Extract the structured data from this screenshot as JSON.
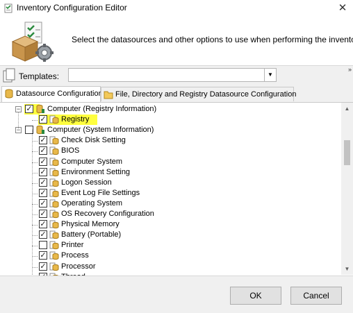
{
  "window": {
    "title": "Inventory Configuration Editor"
  },
  "header": {
    "text": "Select the datasources and other options to use when performing the inventory"
  },
  "templates": {
    "label": "Templates:",
    "value": ""
  },
  "tabs": [
    {
      "label": "Datasource Configuration",
      "active": true
    },
    {
      "label": "File, Directory and Registry Datasource Configuration",
      "active": false
    }
  ],
  "tree": {
    "nodes": [
      {
        "label": "Computer (Registry Information)",
        "checked": true,
        "expander": "minus",
        "highlighted": true
      },
      {
        "label": "Registry",
        "checked": true,
        "highlighted": true
      },
      {
        "label": "Computer (System Information)",
        "checked": false,
        "expander": "minus"
      },
      {
        "label": "Check Disk Setting",
        "checked": true
      },
      {
        "label": "BIOS",
        "checked": true
      },
      {
        "label": "Computer System",
        "checked": true
      },
      {
        "label": "Environment Setting",
        "checked": true
      },
      {
        "label": "Logon Session",
        "checked": true
      },
      {
        "label": "Event Log File Settings",
        "checked": true
      },
      {
        "label": "Operating System",
        "checked": true
      },
      {
        "label": "OS Recovery Configuration",
        "checked": true
      },
      {
        "label": "Physical Memory",
        "checked": true
      },
      {
        "label": "Battery (Portable)",
        "checked": true
      },
      {
        "label": "Printer",
        "checked": false
      },
      {
        "label": "Process",
        "checked": true
      },
      {
        "label": "Processor",
        "checked": true
      },
      {
        "label": "Thread",
        "checked": true
      }
    ]
  },
  "buttons": {
    "ok": "OK",
    "cancel": "Cancel"
  },
  "icons": {
    "close": "close-icon",
    "dropdown": "chevron-down-icon",
    "more": "double-chevron-right-icon"
  },
  "colors": {
    "highlight": "#ffff3e",
    "accent": "#2b8a3e"
  }
}
